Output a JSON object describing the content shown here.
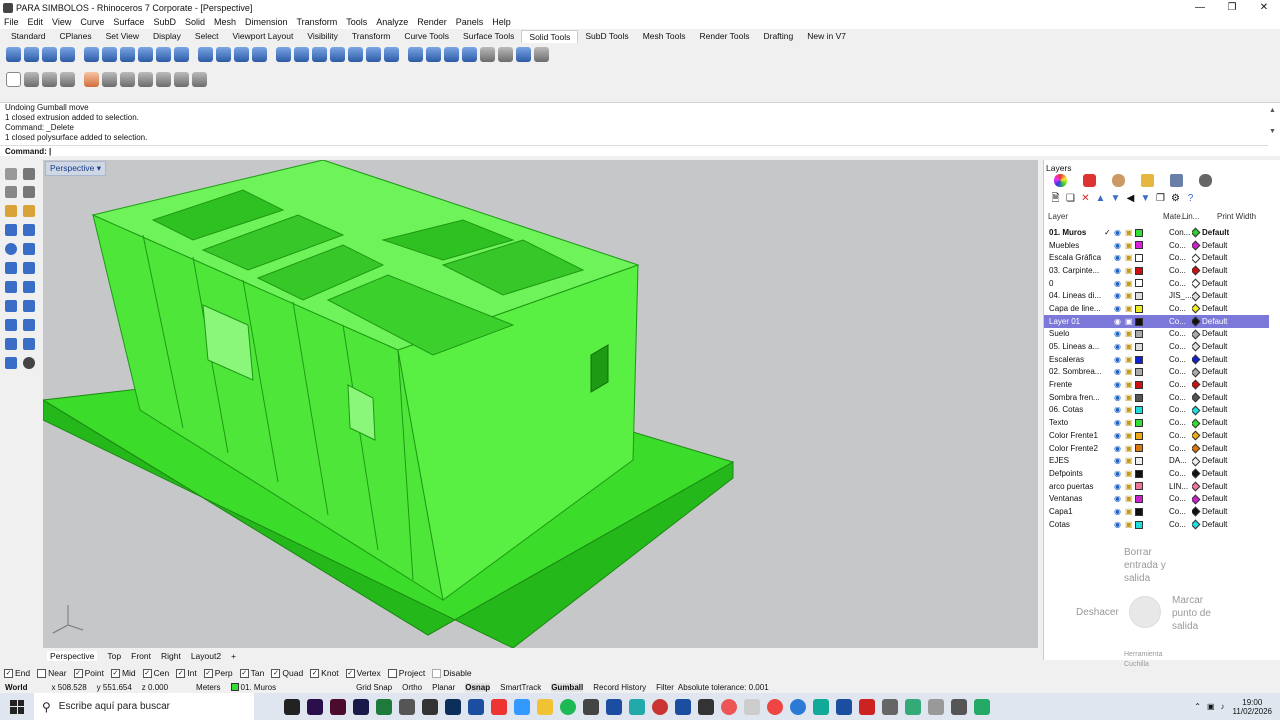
{
  "window": {
    "title": "PARA SIMBOLOS - Rhinoceros 7 Corporate - [Perspective]"
  },
  "menu": [
    "File",
    "Edit",
    "View",
    "Curve",
    "Surface",
    "SubD",
    "Solid",
    "Mesh",
    "Dimension",
    "Transform",
    "Tools",
    "Analyze",
    "Render",
    "Panels",
    "Help"
  ],
  "toolbar_tabs": [
    "Standard",
    "CPlanes",
    "Set View",
    "Display",
    "Select",
    "Viewport Layout",
    "Visibility",
    "Transform",
    "Curve Tools",
    "Surface Tools",
    "Solid Tools",
    "SubD Tools",
    "Mesh Tools",
    "Render Tools",
    "Drafting",
    "New in V7"
  ],
  "active_tab": "Solid Tools",
  "command_history": [
    "Undoing Gumball move",
    "1 closed extrusion added to selection.",
    "Command: _Delete",
    "1 closed polysurface added to selection."
  ],
  "command_prompt": "Command:",
  "viewport": {
    "label": "Perspective"
  },
  "viewport_tabs": [
    "Perspective",
    "Top",
    "Front",
    "Right",
    "Layout2"
  ],
  "osnaps": [
    {
      "label": "End",
      "checked": true
    },
    {
      "label": "Near",
      "checked": false
    },
    {
      "label": "Point",
      "checked": true
    },
    {
      "label": "Mid",
      "checked": true
    },
    {
      "label": "Cen",
      "checked": true
    },
    {
      "label": "Int",
      "checked": true
    },
    {
      "label": "Perp",
      "checked": true
    },
    {
      "label": "Tan",
      "checked": true
    },
    {
      "label": "Quad",
      "checked": true
    },
    {
      "label": "Knot",
      "checked": true
    },
    {
      "label": "Vertex",
      "checked": true
    },
    {
      "label": "Project",
      "checked": false
    },
    {
      "label": "Disable",
      "checked": false
    }
  ],
  "status": {
    "cplane": "World",
    "x": "x 508.528",
    "y": "y 551.654",
    "z": "z 0.000",
    "units": "Meters",
    "layer": "01. Muros",
    "toggles": [
      "Grid Snap",
      "Ortho",
      "Planar",
      "Osnap",
      "SmartTrack",
      "Gumball",
      "Record History",
      "Filter"
    ],
    "tolerance": "Absolute tolerance: 0.001"
  },
  "layers_panel": {
    "title": "Layers",
    "headers": {
      "layer": "Layer",
      "material": "Mate...",
      "linetype": "Lin...",
      "print_width": "Print Width"
    },
    "rows": [
      {
        "name": "01. Muros",
        "color": "#33dd33",
        "lt": "Con...",
        "pw": "Default",
        "dia": "#33cc33",
        "current": true
      },
      {
        "name": "Muebles",
        "color": "#dd22dd",
        "lt": "Co...",
        "pw": "Default",
        "dia": "#cc22cc"
      },
      {
        "name": "Escala Gráfica",
        "color": "#ffffff",
        "lt": "Co...",
        "pw": "Default",
        "dia": "#ffffff"
      },
      {
        "name": "03. Carpinte...",
        "color": "#cc1111",
        "lt": "Co...",
        "pw": "Default",
        "dia": "#cc1111"
      },
      {
        "name": "0",
        "color": "#ffffff",
        "lt": "Co...",
        "pw": "Default",
        "dia": "#ffffff"
      },
      {
        "name": "04. Lineas di...",
        "color": "#dddddd",
        "lt": "JIS_...",
        "pw": "Default",
        "dia": "#dddddd"
      },
      {
        "name": "Capa de line...",
        "color": "#eeee22",
        "lt": "Co...",
        "pw": "Default",
        "dia": "#eeee22"
      },
      {
        "name": "Layer 01",
        "color": "#111111",
        "lt": "Co...",
        "pw": "Default",
        "dia": "#111111",
        "selected": true
      },
      {
        "name": "Suelo",
        "color": "#aaaaaa",
        "lt": "Co...",
        "pw": "Default",
        "dia": "#aaaaaa"
      },
      {
        "name": "05. Lineas a...",
        "color": "#dddddd",
        "lt": "Co...",
        "pw": "Default",
        "dia": "#dddddd"
      },
      {
        "name": "Escaleras",
        "color": "#1122cc",
        "lt": "Co...",
        "pw": "Default",
        "dia": "#1122cc"
      },
      {
        "name": "02. Sombrea...",
        "color": "#aaaaaa",
        "lt": "Co...",
        "pw": "Default",
        "dia": "#aaaaaa"
      },
      {
        "name": "Frente",
        "color": "#cc1111",
        "lt": "Co...",
        "pw": "Default",
        "dia": "#cc1111"
      },
      {
        "name": "Sombra fren...",
        "color": "#555555",
        "lt": "Co...",
        "pw": "Default",
        "dia": "#555555"
      },
      {
        "name": "06. Cotas",
        "color": "#22dddd",
        "lt": "Co...",
        "pw": "Default",
        "dia": "#22dddd"
      },
      {
        "name": "Texto",
        "color": "#33dd33",
        "lt": "Co...",
        "pw": "Default",
        "dia": "#33dd33"
      },
      {
        "name": "Color Frente1",
        "color": "#eeaa11",
        "lt": "Co...",
        "pw": "Default",
        "dia": "#eeaa11"
      },
      {
        "name": "Color Frente2",
        "color": "#dd7711",
        "lt": "Co...",
        "pw": "Default",
        "dia": "#dd7711"
      },
      {
        "name": "EJES",
        "color": "#eeeeee",
        "lt": "DA...",
        "pw": "Default",
        "dia": "#eeeeee"
      },
      {
        "name": "Defpoints",
        "color": "#111111",
        "lt": "Co...",
        "pw": "Default",
        "dia": "#111111"
      },
      {
        "name": "arco puertas",
        "color": "#ee7799",
        "lt": "LIN...",
        "pw": "Default",
        "dia": "#ee7799"
      },
      {
        "name": "Ventanas",
        "color": "#cc22cc",
        "lt": "Co...",
        "pw": "Default",
        "dia": "#cc22cc"
      },
      {
        "name": "Capa1",
        "color": "#111111",
        "lt": "Co...",
        "pw": "Default",
        "dia": "#111111"
      },
      {
        "name": "Cotas",
        "color": "#22dddd",
        "lt": "Co...",
        "pw": "Default",
        "dia": "#22dddd"
      }
    ]
  },
  "radial_menu": {
    "top": "Borrar entrada y salida",
    "left": "Deshacer",
    "right": "Marcar punto de salida",
    "bottom": "Herramienta Cuchilla"
  },
  "taskbar": {
    "search_placeholder": "Escribe aquí para buscar",
    "time": "19:00",
    "date": "11/02/2026"
  }
}
